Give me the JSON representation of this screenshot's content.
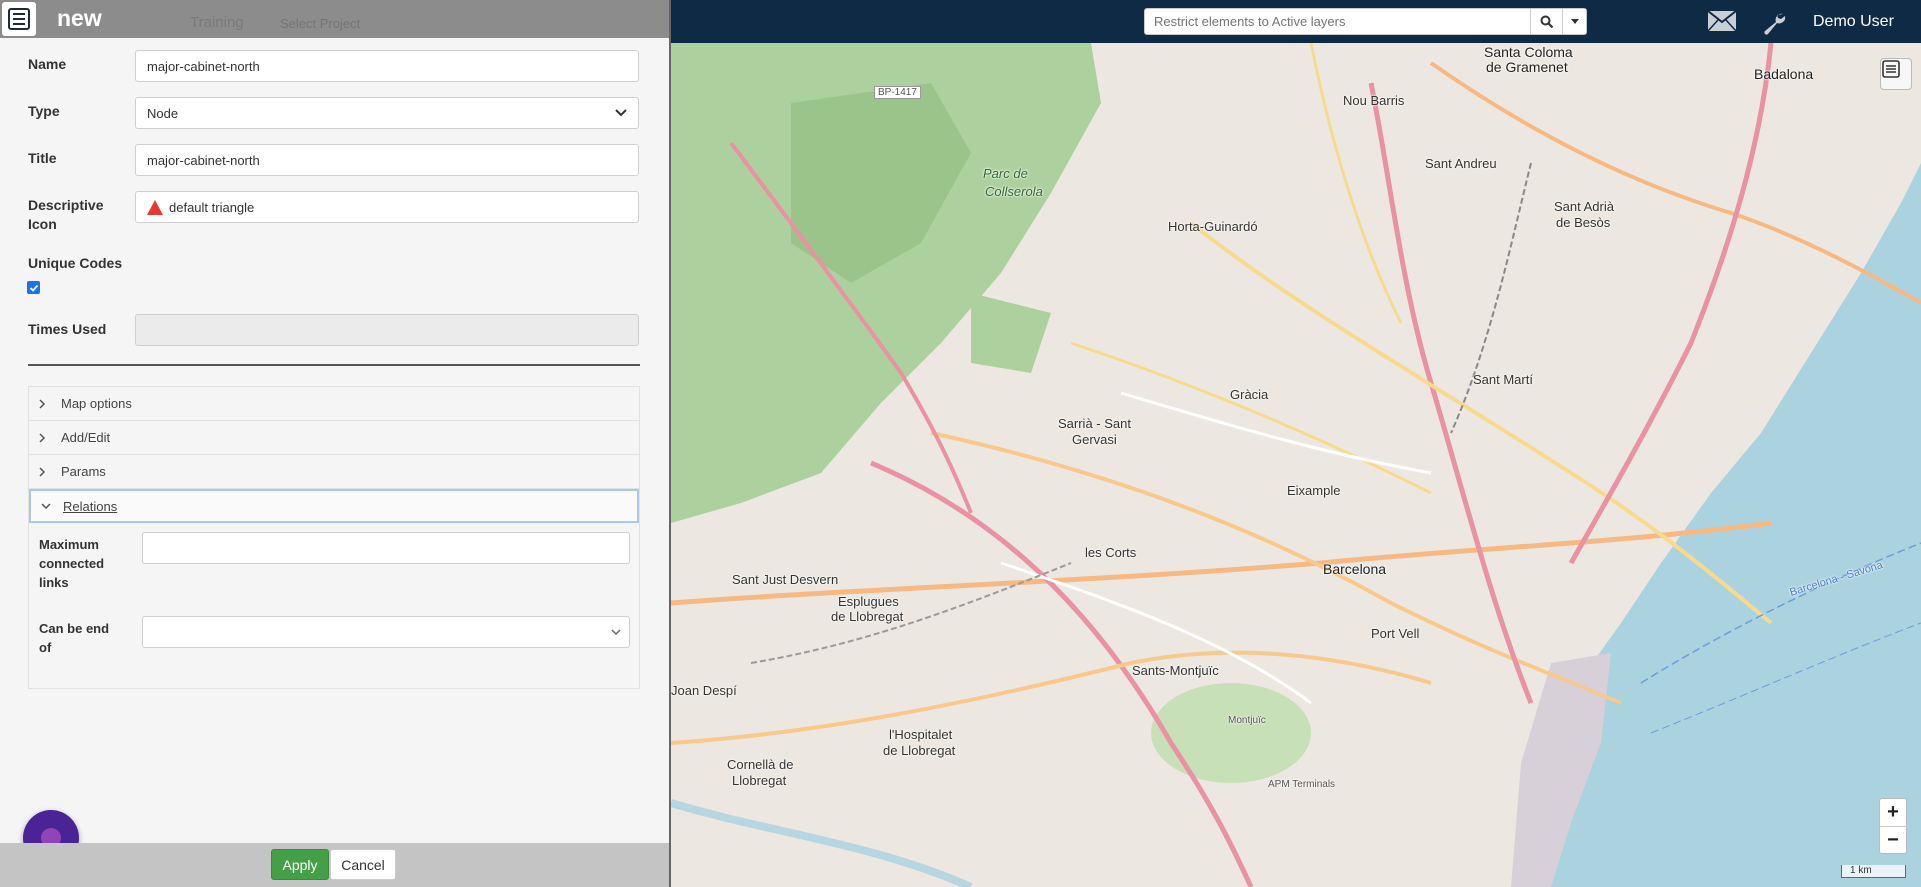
{
  "panel": {
    "title": "new",
    "header_faded_tab": "Training",
    "header_faded_project": "Select Project"
  },
  "form": {
    "name_label": "Name",
    "name_value": "major-cabinet-north",
    "type_label": "Type",
    "type_value": "Node",
    "title_label": "Title",
    "title_value": "major-cabinet-north",
    "icon_label_line1": "Descriptive",
    "icon_label_line2": "Icon",
    "icon_value": "default triangle",
    "unique_codes_label": "Unique Codes",
    "unique_codes_checked": true,
    "times_used_label": "Times Used",
    "times_used_value": ""
  },
  "accordion": {
    "items": [
      {
        "label": "Map options",
        "expanded": false
      },
      {
        "label": "Add/Edit",
        "expanded": false
      },
      {
        "label": "Params",
        "expanded": false
      },
      {
        "label": "Relations",
        "expanded": true
      }
    ],
    "relations": {
      "max_links_line1": "Maximum",
      "max_links_line2": "connected",
      "max_links_line3": "links",
      "max_links_value": "",
      "end_of_line1": "Can be end",
      "end_of_line2": "of",
      "end_of_value": ""
    }
  },
  "footer": {
    "apply_label": "Apply",
    "cancel_label": "Cancel"
  },
  "topbar": {
    "search_placeholder": "Restrict elements to Active layers",
    "user_name": "Demo User"
  },
  "map": {
    "labels": {
      "santa_coloma": "Santa Coloma",
      "de_gramenet": "de Gramenet",
      "badalona": "Badalona",
      "nou_barris": "Nou Barris",
      "sant_andreu": "Sant Andreu",
      "parc_de": "Parc de",
      "collserola": "Collserola",
      "horta_guinardo": "Horta-Guinardó",
      "sant_adria": "Sant Adrià",
      "de_besos": "de Besòs",
      "sant_marti": "Sant Martí",
      "gracia": "Gràcia",
      "sarria": "Sarrià - Sant",
      "gervasi": "Gervasi",
      "eixample": "Eixample",
      "les_corts": "les Corts",
      "barcelona": "Barcelona",
      "sant_just": "Sant Just Desvern",
      "esplugues": "Esplugues",
      "de_llobregat": "de Llobregat",
      "port_vell": "Port Vell",
      "sants_montjuic": "Sants-Montjuïc",
      "sant_joan": "Joan Despí",
      "hospitalet": "l'Hospitalet",
      "hospitalet2": "de Llobregat",
      "cornella": "Cornellà de",
      "cornella2": "Llobregat",
      "bp1417": "BP-1417",
      "montjuic": "Montjuïc",
      "apm": "APM Terminals",
      "sea": "Barcelona - Savona"
    },
    "scale_label": "1 km",
    "zoom_in": "+",
    "zoom_out": "−"
  },
  "colors": {
    "topbar": "#0e2a44",
    "apply_green": "#43a047",
    "fab_purple": "#4a2496",
    "sea": "#a9d3df",
    "park": "#add19e"
  }
}
